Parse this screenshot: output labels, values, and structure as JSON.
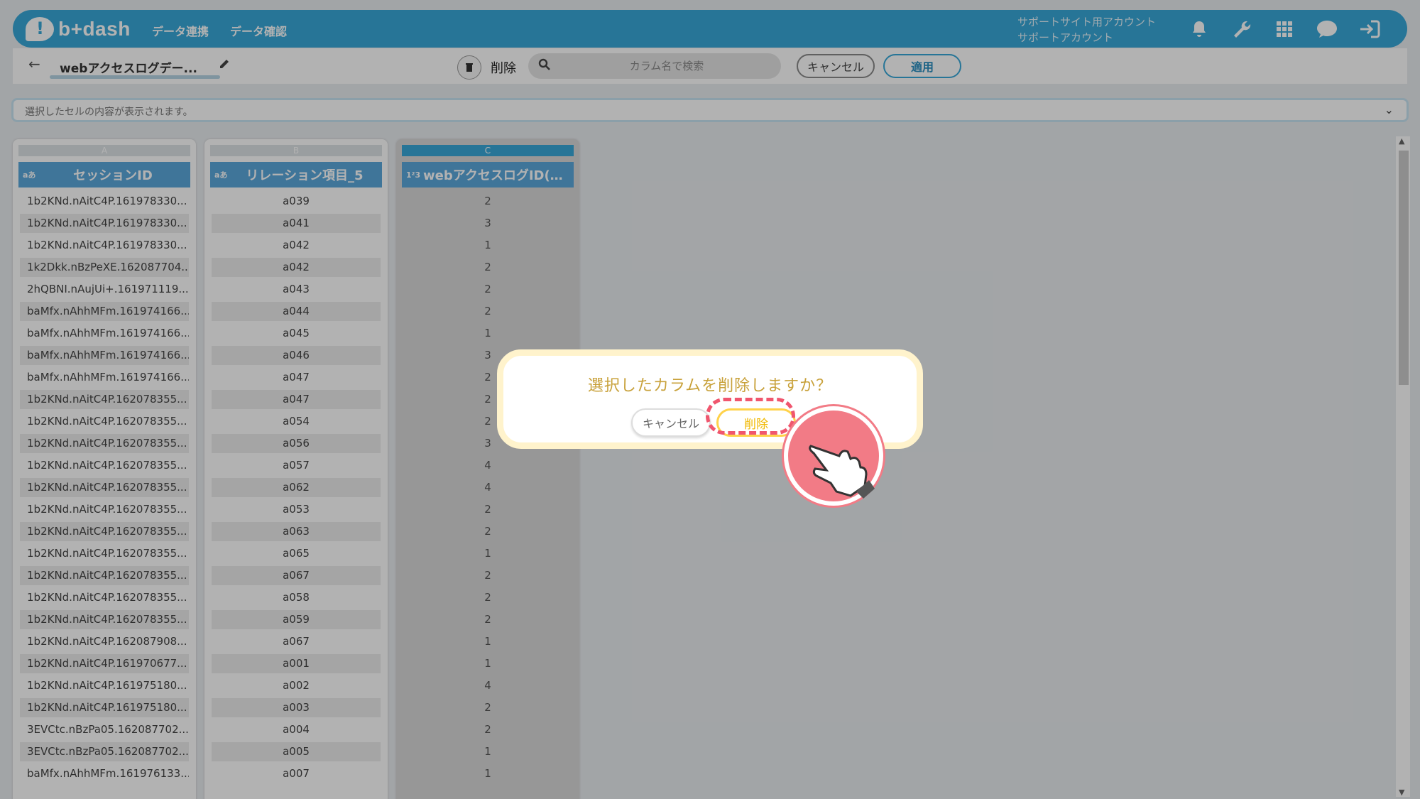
{
  "app": {
    "logo_text": "b+dash",
    "nav": [
      "データ連携",
      "データ確認"
    ],
    "account_line1": "サポートサイト用アカウント",
    "account_line2": "サポートアカウント",
    "icons": [
      "bell-icon",
      "wrench-icon",
      "grid-icon",
      "chat-icon",
      "logout-icon"
    ]
  },
  "toolbar": {
    "back_icon": "←",
    "title": "webアクセスログデー...",
    "delete_label": "削除",
    "search_placeholder": "カラム名で検索",
    "cancel_label": "キャンセル",
    "apply_label": "適用"
  },
  "cellbar": {
    "placeholder": "選択したセルの内容が表示されます。"
  },
  "columns": [
    {
      "letter": "A",
      "type": "aあ",
      "name": "セッションID",
      "cells": [
        "1b2KNd.nAitC4P.161978330...",
        "1b2KNd.nAitC4P.161978330...",
        "1b2KNd.nAitC4P.161978330...",
        "1k2Dkk.nBzPeXE.162087704...",
        "2hQBNI.nAujUi+.161971119...",
        "baMfx.nAhhMFm.161974166...",
        "baMfx.nAhhMFm.161974166...",
        "baMfx.nAhhMFm.161974166...",
        "baMfx.nAhhMFm.161974166...",
        "1b2KNd.nAitC4P.162078355...",
        "1b2KNd.nAitC4P.162078355...",
        "1b2KNd.nAitC4P.162078355...",
        "1b2KNd.nAitC4P.162078355...",
        "1b2KNd.nAitC4P.162078355...",
        "1b2KNd.nAitC4P.162078355...",
        "1b2KNd.nAitC4P.162078355...",
        "1b2KNd.nAitC4P.162078355...",
        "1b2KNd.nAitC4P.162078355...",
        "1b2KNd.nAitC4P.162078355...",
        "1b2KNd.nAitC4P.162078355...",
        "1b2KNd.nAitC4P.162087908...",
        "1b2KNd.nAitC4P.161970677...",
        "1b2KNd.nAitC4P.161975180...",
        "1b2KNd.nAitC4P.161975180...",
        "3EVCtc.nBzPa05.162087702...",
        "3EVCtc.nBzPa05.162087702...",
        "baMfx.nAhhMFm.161976133..."
      ]
    },
    {
      "letter": "B",
      "type": "aあ",
      "name": "リレーション項目_5",
      "cells": [
        "a039",
        "a041",
        "a042",
        "a042",
        "a043",
        "a044",
        "a045",
        "a046",
        "a047",
        "a047",
        "a054",
        "a056",
        "a057",
        "a062",
        "a053",
        "a063",
        "a065",
        "a067",
        "a058",
        "a059",
        "a067",
        "a001",
        "a002",
        "a003",
        "a004",
        "a005",
        "a007"
      ]
    },
    {
      "letter": "C",
      "type": "1²3",
      "name": "webアクセスログID(…",
      "cells": [
        "2",
        "3",
        "1",
        "2",
        "2",
        "2",
        "1",
        "3",
        "2",
        "2",
        "2",
        "3",
        "4",
        "4",
        "2",
        "2",
        "1",
        "2",
        "2",
        "2",
        "1",
        "1",
        "4",
        "2",
        "2",
        "1",
        "1"
      ]
    }
  ],
  "modal": {
    "message": "選択したカラムを削除しますか？",
    "cancel_label": "キャンセル",
    "delete_label": "削除"
  },
  "colors": {
    "brand": "#38a8d8",
    "header": "#5ba8dc",
    "modal_text": "#c8a13a",
    "delete_accent": "#ffd24a",
    "highlight": "#f0566e"
  }
}
